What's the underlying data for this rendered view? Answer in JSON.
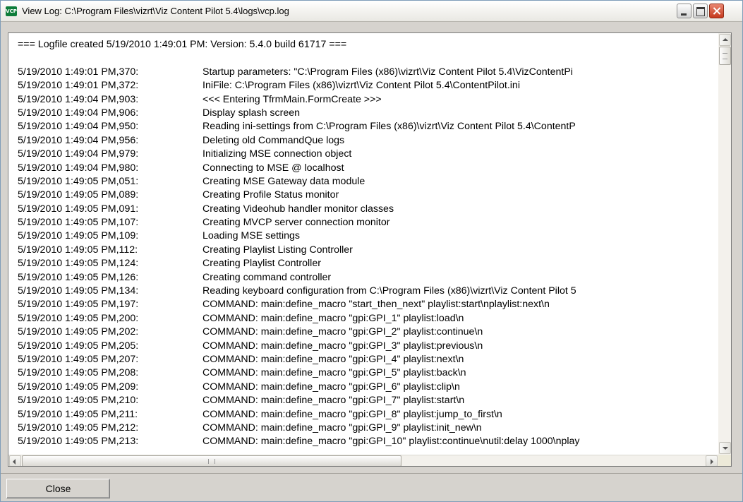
{
  "window": {
    "title": "View Log: C:\\Program Files\\vizrt\\Viz Content Pilot 5.4\\logs\\vcp.log",
    "icon_label": "VCP"
  },
  "log": {
    "header": "=== Logfile created 5/19/2010 1:49:01 PM: Version: 5.4.0 build 61717 ===",
    "rows": [
      {
        "ts": "5/19/2010 1:49:01 PM,370:",
        "msg": "Startup parameters: \"C:\\Program Files (x86)\\vizrt\\Viz Content Pilot 5.4\\VizContentPi"
      },
      {
        "ts": "5/19/2010 1:49:01 PM,372:",
        "msg": "IniFile: C:\\Program Files (x86)\\vizrt\\Viz Content Pilot 5.4\\ContentPilot.ini"
      },
      {
        "ts": "5/19/2010 1:49:04 PM,903:",
        "msg": "<<< Entering TfrmMain.FormCreate >>>"
      },
      {
        "ts": "5/19/2010 1:49:04 PM,906:",
        "msg": "Display splash screen"
      },
      {
        "ts": "5/19/2010 1:49:04 PM,950:",
        "msg": "Reading ini-settings from C:\\Program Files (x86)\\vizrt\\Viz Content Pilot 5.4\\ContentP"
      },
      {
        "ts": "5/19/2010 1:49:04 PM,956:",
        "msg": "Deleting old CommandQue logs"
      },
      {
        "ts": "5/19/2010 1:49:04 PM,979:",
        "msg": "Initializing MSE connection object"
      },
      {
        "ts": "5/19/2010 1:49:04 PM,980:",
        "msg": "Connecting to MSE @ localhost"
      },
      {
        "ts": "5/19/2010 1:49:05 PM,051:",
        "msg": "Creating MSE Gateway data module"
      },
      {
        "ts": "5/19/2010 1:49:05 PM,089:",
        "msg": "Creating Profile Status monitor"
      },
      {
        "ts": "5/19/2010 1:49:05 PM,091:",
        "msg": "Creating Videohub handler monitor classes"
      },
      {
        "ts": "5/19/2010 1:49:05 PM,107:",
        "msg": "Creating MVCP server connection monitor"
      },
      {
        "ts": "5/19/2010 1:49:05 PM,109:",
        "msg": "Loading MSE settings"
      },
      {
        "ts": "5/19/2010 1:49:05 PM,112:",
        "msg": "Creating Playlist Listing Controller"
      },
      {
        "ts": "5/19/2010 1:49:05 PM,124:",
        "msg": "Creating Playlist Controller"
      },
      {
        "ts": "5/19/2010 1:49:05 PM,126:",
        "msg": "Creating command controller"
      },
      {
        "ts": "5/19/2010 1:49:05 PM,134:",
        "msg": "Reading keyboard configuration from C:\\Program Files (x86)\\vizrt\\Viz Content Pilot 5"
      },
      {
        "ts": "5/19/2010 1:49:05 PM,197:",
        "msg": "COMMAND: main:define_macro \"start_then_next\" playlist:start\\nplaylist:next\\n"
      },
      {
        "ts": "5/19/2010 1:49:05 PM,200:",
        "msg": "COMMAND: main:define_macro \"gpi:GPI_1\" playlist:load\\n"
      },
      {
        "ts": "5/19/2010 1:49:05 PM,202:",
        "msg": "COMMAND: main:define_macro \"gpi:GPI_2\" playlist:continue\\n"
      },
      {
        "ts": "5/19/2010 1:49:05 PM,205:",
        "msg": "COMMAND: main:define_macro \"gpi:GPI_3\" playlist:previous\\n"
      },
      {
        "ts": "5/19/2010 1:49:05 PM,207:",
        "msg": "COMMAND: main:define_macro \"gpi:GPI_4\" playlist:next\\n"
      },
      {
        "ts": "5/19/2010 1:49:05 PM,208:",
        "msg": "COMMAND: main:define_macro \"gpi:GPI_5\" playlist:back\\n"
      },
      {
        "ts": "5/19/2010 1:49:05 PM,209:",
        "msg": "COMMAND: main:define_macro \"gpi:GPI_6\" playlist:clip\\n"
      },
      {
        "ts": "5/19/2010 1:49:05 PM,210:",
        "msg": "COMMAND: main:define_macro \"gpi:GPI_7\" playlist:start\\n"
      },
      {
        "ts": "5/19/2010 1:49:05 PM,211:",
        "msg": "COMMAND: main:define_macro \"gpi:GPI_8\" playlist:jump_to_first\\n"
      },
      {
        "ts": "5/19/2010 1:49:05 PM,212:",
        "msg": "COMMAND: main:define_macro \"gpi:GPI_9\" playlist:init_new\\n"
      },
      {
        "ts": "5/19/2010 1:49:05 PM,213:",
        "msg": "COMMAND: main:define_macro \"gpi:GPI_10\" playlist:continue\\nutil:delay 1000\\nplay"
      }
    ]
  },
  "footer": {
    "close_label": "Close"
  },
  "colors": {
    "window_bg": "#d6d3ce",
    "close_button_red": "#c5391d"
  }
}
